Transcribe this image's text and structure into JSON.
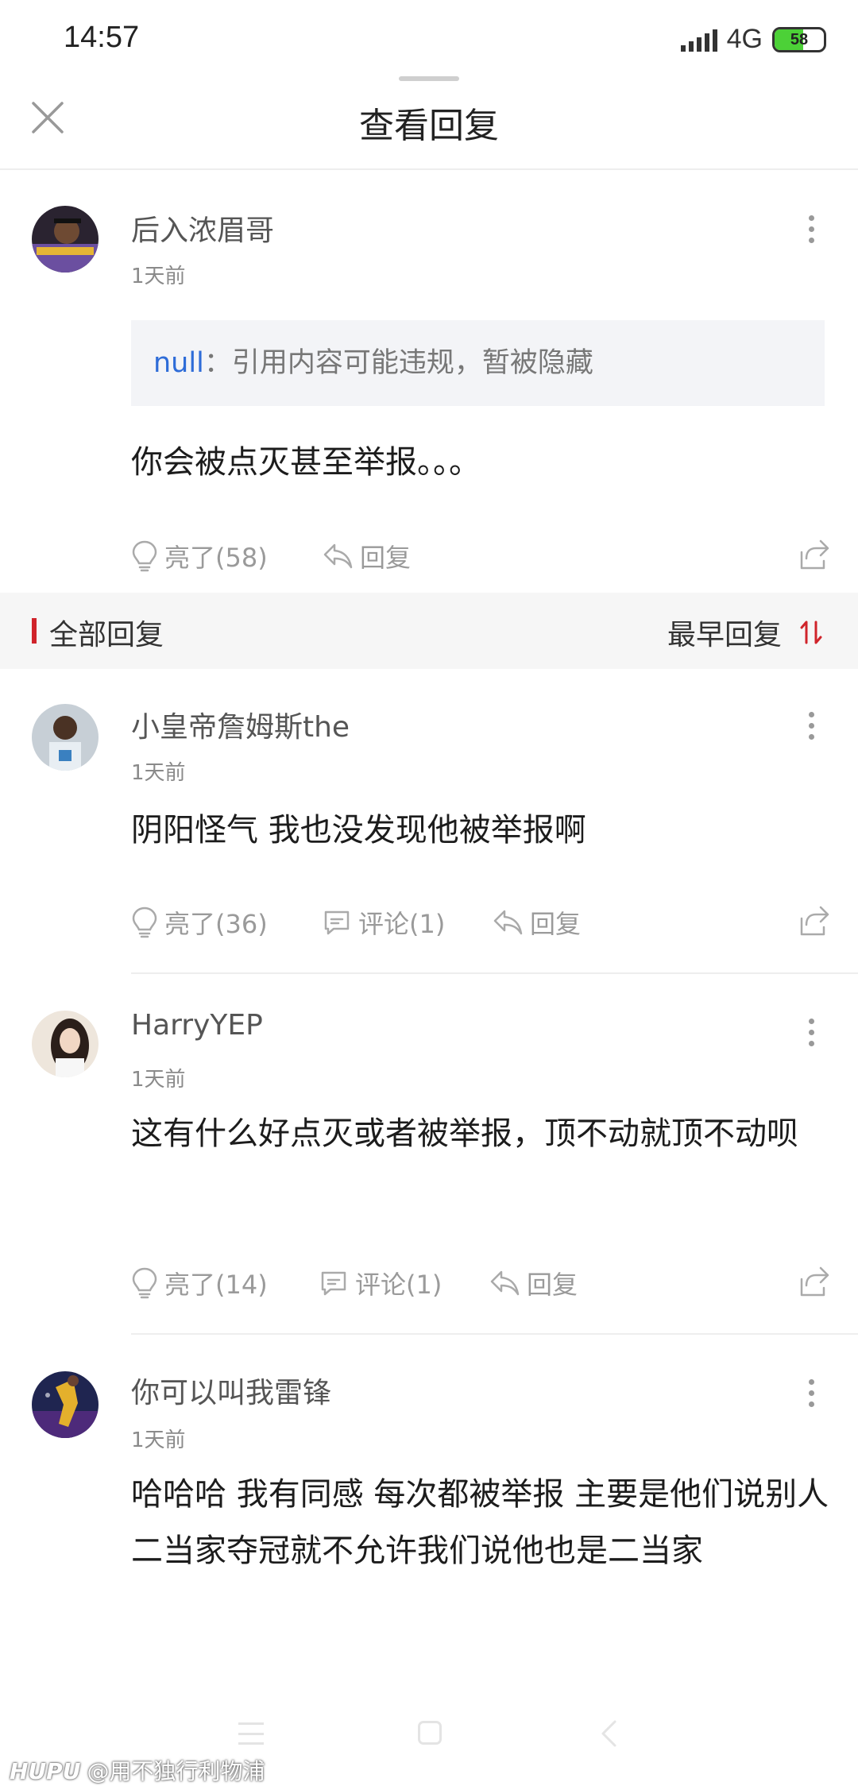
{
  "status_bar": {
    "time": "14:57",
    "network": "4G",
    "battery": "58",
    "battery_level": 0.58
  },
  "header": {
    "title": "查看回复"
  },
  "main_post": {
    "username": "后入浓眉哥",
    "time": "1天前",
    "quote_user": "null",
    "quote_text": "：引用内容可能违规，暂被隐藏",
    "content": "你会被点灭甚至举报。。。",
    "like_label": "亮了(58)",
    "reply_label": "回复"
  },
  "section": {
    "title": "全部回复",
    "sort_label": "最早回复",
    "accent_color": "#d0242b"
  },
  "replies": [
    {
      "username": "小皇帝詹姆斯the",
      "time": "1天前",
      "content": "阴阳怪气 我也没发现他被举报啊",
      "like_label": "亮了(36)",
      "comment_label": "评论(1)",
      "reply_label": "回复"
    },
    {
      "username": "HarryYEP",
      "time": "1天前",
      "content": "这有什么好点灭或者被举报，顶不动就顶不动呗",
      "like_label": "亮了(14)",
      "comment_label": "评论(1)",
      "reply_label": "回复"
    },
    {
      "username": "你可以叫我雷锋",
      "time": "1天前",
      "content": "哈哈哈 我有同感 每次都被举报 主要是他们说别人二当家夺冠就不允许我们说他也是二当家"
    }
  ],
  "watermark": {
    "logo": "HUPU",
    "text": "@用不独行利物浦"
  }
}
